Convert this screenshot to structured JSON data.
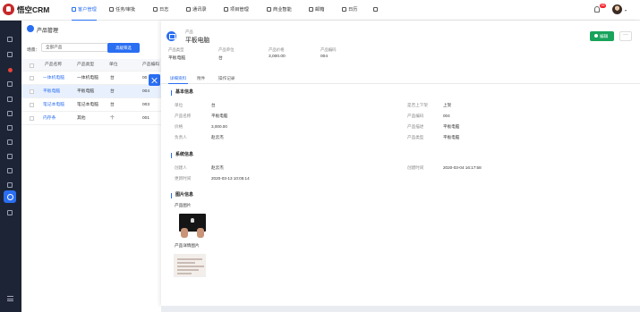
{
  "app": {
    "name": "悟空CRM"
  },
  "nav": [
    {
      "label": "客户管理",
      "icon": "customer-icon",
      "active": true
    },
    {
      "label": "任务/审批",
      "icon": "task-icon"
    },
    {
      "label": "日志",
      "icon": "log-icon"
    },
    {
      "label": "通讯录",
      "icon": "contacts-icon"
    },
    {
      "label": "项目管理",
      "icon": "project-icon"
    },
    {
      "label": "商业智能",
      "icon": "bi-icon"
    },
    {
      "label": "邮箱",
      "icon": "mail-icon"
    },
    {
      "label": "日历",
      "icon": "calendar-icon"
    },
    {
      "label": "",
      "icon": "apps-grid-icon"
    }
  ],
  "header": {
    "notification_count": "99"
  },
  "colors": {
    "accent": "#2a6ef2",
    "sidebar": "#1c2435",
    "edit": "#19a35b"
  },
  "list_panel": {
    "title": "产品管理",
    "scene_label": "场景：",
    "scene_value": "全部产品",
    "advanced_filter_label": "高级筛选",
    "columns": [
      "产品名称",
      "产品类型",
      "单位",
      "产品编码"
    ],
    "rows": [
      {
        "name": "一体机电脑",
        "type": "一体机电脑",
        "unit": "台",
        "code": "00"
      },
      {
        "name": "平板电脑",
        "type": "平板电脑",
        "unit": "台",
        "code": "004"
      },
      {
        "name": "笔记本电脑",
        "type": "笔记本电脑",
        "unit": "台",
        "code": "003"
      },
      {
        "name": "内存条",
        "type": "其他",
        "unit": "个",
        "code": "001"
      }
    ]
  },
  "detail": {
    "type_label": "产品",
    "name": "平板电脑",
    "edit_label": "编辑",
    "more_label": "···",
    "summary": [
      {
        "label": "产品类型",
        "value": "平板电脑"
      },
      {
        "label": "产品单位",
        "value": "台"
      },
      {
        "label": "产品价格",
        "value": "3,000.00"
      },
      {
        "label": "产品编码",
        "value": "004"
      }
    ],
    "tabs": [
      "详细资料",
      "附件",
      "操作记录"
    ],
    "basic_title": "基本信息",
    "basic_left": [
      {
        "label": "单位",
        "value": "台"
      },
      {
        "label": "产品名称",
        "value": "平板电脑"
      },
      {
        "label": "价格",
        "value": "3,000.00"
      },
      {
        "label": "负责人",
        "value": "赵云杰"
      }
    ],
    "basic_right": [
      {
        "label": "是否上下架",
        "value": "上架"
      },
      {
        "label": "产品编码",
        "value": "004"
      },
      {
        "label": "产品描述",
        "value": "平板电脑"
      },
      {
        "label": "产品类型",
        "value": "平板电脑"
      }
    ],
    "system_title": "系统信息",
    "system": [
      {
        "label": "创建人",
        "value": "赵云杰"
      },
      {
        "label": "更新时间",
        "value": "2020-03-13 10:05:14"
      },
      {
        "label": "创建时间",
        "value": "2020-03-04 16:17:58"
      }
    ],
    "image_title": "图片信息",
    "image_label": "产品图片",
    "image_detail_label": "产品详情图片"
  }
}
